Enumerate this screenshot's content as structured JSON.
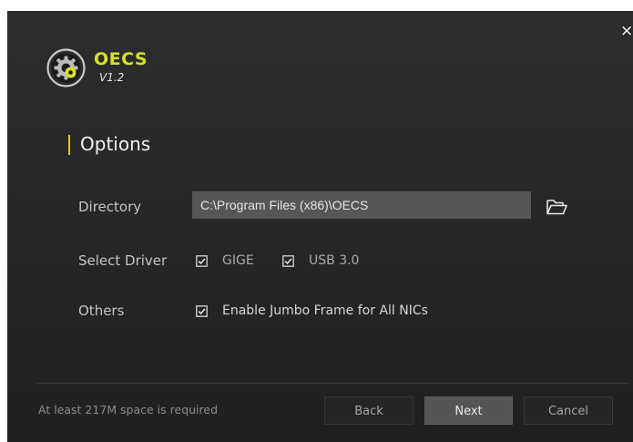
{
  "window": {
    "close_glyph": "×"
  },
  "app": {
    "logo_icon": "gear-camera-logo-icon",
    "name": "OECS",
    "version": "V1.2",
    "accent_color": "#d6df2f"
  },
  "section": {
    "title": "Options",
    "marker_color": "#e8c21c"
  },
  "directory": {
    "label": "Directory",
    "value": "C:\\Program Files (x86)\\OECS",
    "browse_icon": "folder-open-icon"
  },
  "driver": {
    "label": "Select Driver",
    "options": [
      {
        "label": "GIGE",
        "checked": true
      },
      {
        "label": "USB 3.0",
        "checked": true
      }
    ]
  },
  "others": {
    "label": "Others",
    "options": [
      {
        "label": "Enable Jumbo Frame for All NICs",
        "checked": true
      }
    ]
  },
  "footer": {
    "note": "At least 217M space is required",
    "back_label": "Back",
    "next_label": "Next",
    "cancel_label": "Cancel"
  }
}
